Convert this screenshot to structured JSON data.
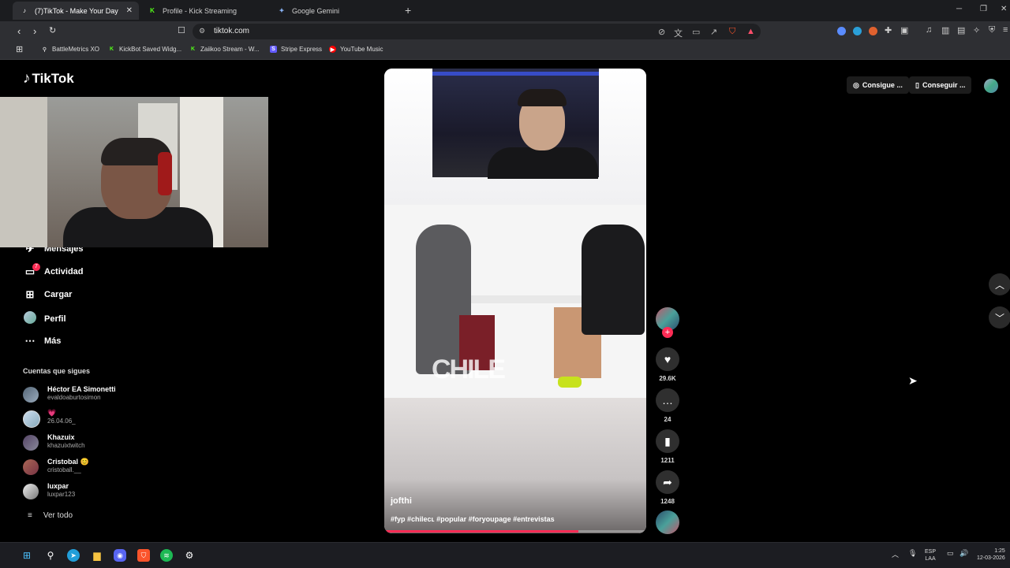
{
  "browser": {
    "tabs": [
      {
        "label": "(7)TikTok - Make Your Day",
        "close": "✕",
        "active": true
      },
      {
        "label": "Profile - Kick Streaming"
      },
      {
        "label": "Google Gemini"
      }
    ],
    "new_tab": "+",
    "url": "tiktok.com",
    "bookmarks": [
      {
        "label": "BattleMetrics XO"
      },
      {
        "label": "KickBot Saved Widg..."
      },
      {
        "label": "Zaiikoo Stream - W..."
      },
      {
        "label": "Stripe Express"
      },
      {
        "label": "YouTube Music"
      }
    ]
  },
  "tiktok": {
    "brand": "TikTok",
    "nav": [
      {
        "label": "Mensajes",
        "icon": "paper-plane-icon"
      },
      {
        "label": "Actividad",
        "icon": "message-bubble-icon",
        "badge": "7"
      },
      {
        "label": "Cargar",
        "icon": "plus-square-icon"
      },
      {
        "label": "Perfil",
        "icon": "avatar"
      },
      {
        "label": "Más",
        "icon": "more-icon"
      }
    ],
    "following_heading": "Cuentas que sigues",
    "following": [
      {
        "name": "Héctor EA Simonetti",
        "handle": "evaldoaburtosimon"
      },
      {
        "name": "💗",
        "handle": "26.04.06_"
      },
      {
        "name": "Khazuix",
        "handle": "khazuixtwitch"
      },
      {
        "name": "Cristobal 😊",
        "handle": "cristoball.__"
      },
      {
        "name": "luxpar",
        "handle": "luxpar123"
      }
    ],
    "see_all": "Ver todo",
    "top_right": {
      "coins_btn": "Consigue ...",
      "app_btn": "Conseguir ..."
    }
  },
  "video": {
    "watermark": "CHILE",
    "author": "jofthi",
    "caption": "#fyp #chileᴄʟ #popular #foryoupage #entrevistas",
    "progress": 0.74,
    "likes": "29.6K",
    "comments": "24",
    "saves": "1211",
    "shares": "1248"
  },
  "taskbar": {
    "lang_top": "ESP",
    "lang_bottom": "LAA",
    "time": "1:25",
    "date": "12-03-2026"
  },
  "colors": {
    "accent": "#fe2c55",
    "bg": "#000000",
    "chrome": "#2e2f33"
  }
}
